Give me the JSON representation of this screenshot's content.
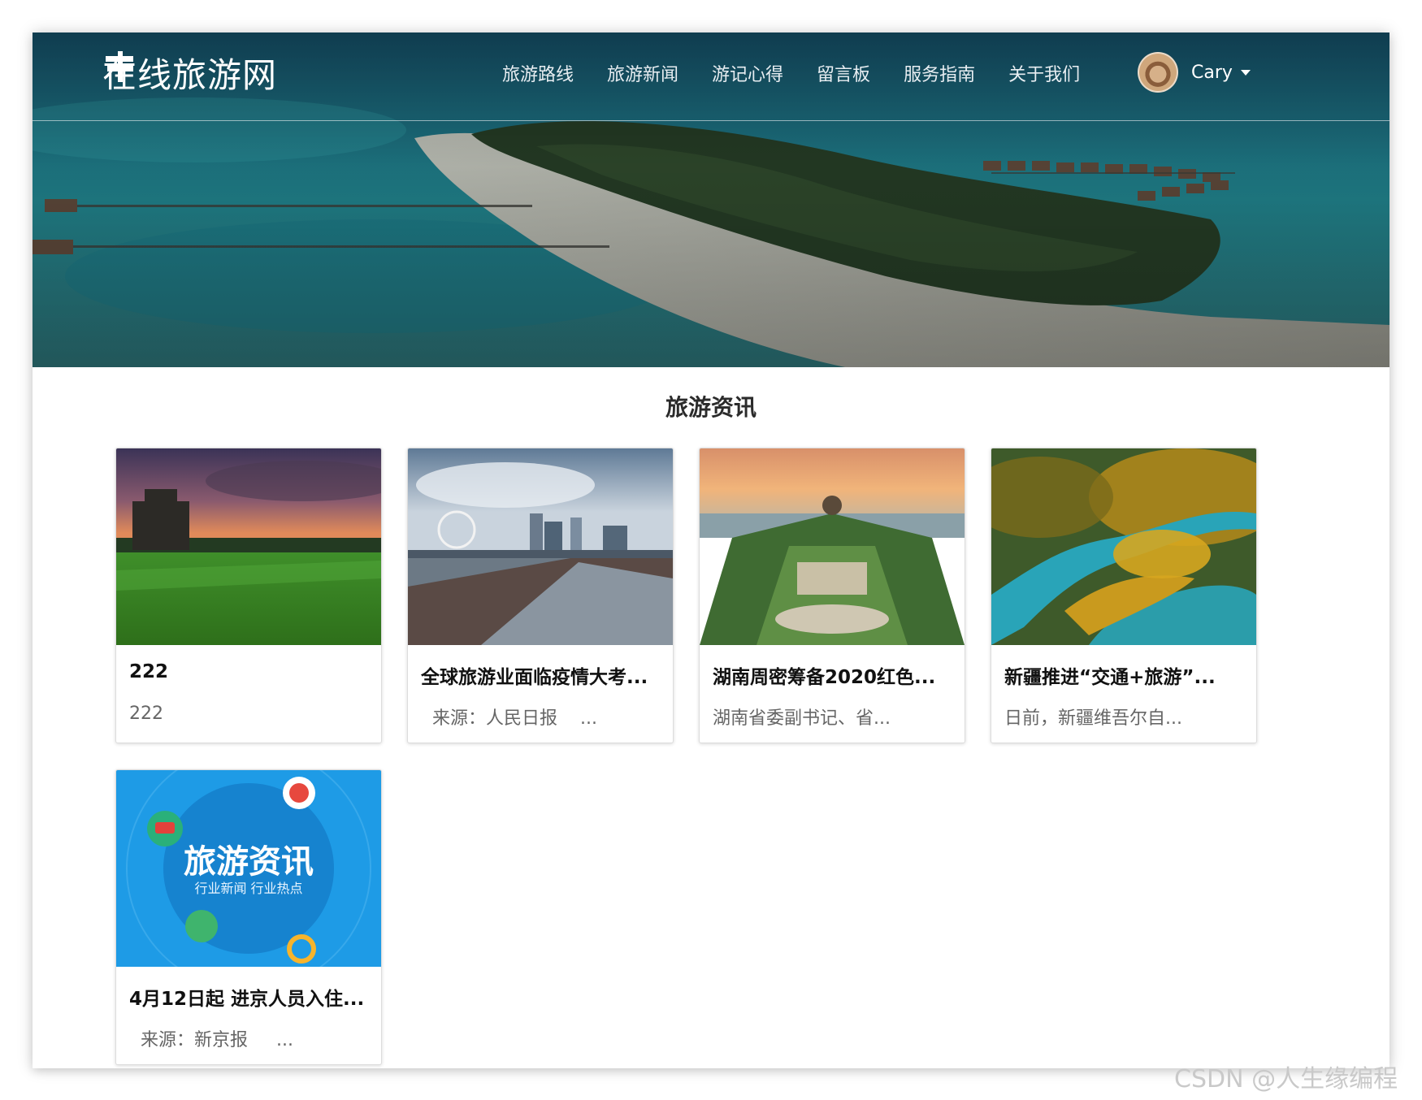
{
  "site": {
    "brand_title": "在线旅游网",
    "nav_items": [
      "旅游路线",
      "旅游新闻",
      "游记心得",
      "留言板",
      "服务指南",
      "关于我们"
    ],
    "user_name": "Cary"
  },
  "main": {
    "section_title": "旅游资讯",
    "cards": [
      {
        "title": "222",
        "summary": "222"
      },
      {
        "title": "全球旅游业面临疫情大考...",
        "summary": "  来源：人民日报    ..."
      },
      {
        "title": "湖南周密筹备2020红色...",
        "summary": "湖南省委副书记、省..."
      },
      {
        "title": "新疆推进“交通+旅游”...",
        "summary": "日前，新疆维吾尔自..."
      },
      {
        "title": "4月12日起 进京人员入住...",
        "summary": "  来源：新京报     ..."
      }
    ],
    "card5_image_text": {
      "headline": "旅游资讯",
      "subline": "行业新闻 行业热点"
    }
  },
  "watermark": "CSDN @人生缘编程",
  "colors": {
    "nav_text": "#e8eef2",
    "title_text": "#2b2b2b",
    "summary_text": "#666666",
    "card5_bg": "#1e9be6"
  }
}
